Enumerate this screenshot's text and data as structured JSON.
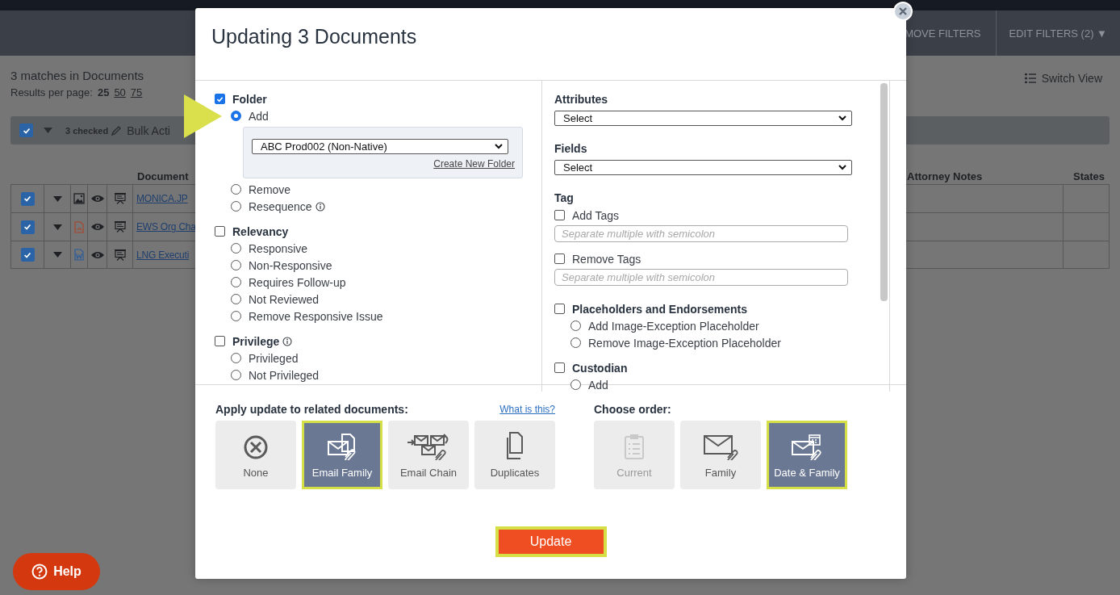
{
  "header": {
    "filters": [
      {
        "label": "MOVE FILTERS"
      },
      {
        "label": "EDIT FILTERS (2) ▼"
      }
    ]
  },
  "results": {
    "title": "3 matches in Documents",
    "per_page_label": "Results per page:",
    "per_page_options": [
      {
        "label": "25",
        "selected": true
      },
      {
        "label": "50",
        "selected": false
      },
      {
        "label": "75",
        "selected": false
      }
    ],
    "switch_view": "Switch View"
  },
  "toolbar": {
    "select_all_checked": true,
    "checked_count": "3 checked",
    "bulk_actions": "Bulk Acti"
  },
  "table": {
    "columns": [
      {
        "label": "Document"
      },
      {
        "label": "Attorney Notes"
      },
      {
        "label": "States"
      }
    ],
    "rows": [
      {
        "checked": true,
        "kind": "image",
        "document": "MONICA.JP"
      },
      {
        "checked": true,
        "kind": "pdf",
        "document": "EWS Org Cha"
      },
      {
        "checked": true,
        "kind": "word",
        "document": "LNG Executi"
      }
    ]
  },
  "help_button": "Help",
  "modal": {
    "title": "Updating 3 Documents",
    "left_sections": [
      {
        "kind": "options",
        "label": "Folder",
        "checked": true,
        "info": false,
        "options": [
          {
            "label": "Add",
            "selected": true,
            "info": false,
            "pointed": true,
            "panel": {
              "select_value": "ABC Prod002 (Non-Native)",
              "link": "Create New Folder"
            }
          },
          {
            "label": "Remove",
            "selected": false,
            "info": false,
            "pointed": false
          },
          {
            "label": "Resequence",
            "selected": false,
            "info": true,
            "pointed": false
          }
        ]
      },
      {
        "kind": "options",
        "label": "Relevancy",
        "checked": false,
        "info": false,
        "options": [
          {
            "label": "Responsive",
            "selected": false,
            "info": false,
            "pointed": false
          },
          {
            "label": "Non-Responsive",
            "selected": false,
            "info": false,
            "pointed": false
          },
          {
            "label": "Requires Follow-up",
            "selected": false,
            "info": false,
            "pointed": false
          },
          {
            "label": "Not Reviewed",
            "selected": false,
            "info": false,
            "pointed": false
          },
          {
            "label": "Remove Responsive Issue",
            "selected": false,
            "info": false,
            "pointed": false
          }
        ]
      },
      {
        "kind": "options",
        "label": "Privilege",
        "checked": false,
        "info": true,
        "options": [
          {
            "label": "Privileged",
            "selected": false,
            "info": false,
            "pointed": false
          },
          {
            "label": "Not Privileged",
            "selected": false,
            "info": false,
            "pointed": false
          }
        ]
      }
    ],
    "right_sections": [
      {
        "kind": "select",
        "label": "Attributes",
        "value": "Select"
      },
      {
        "kind": "select",
        "label": "Fields",
        "value": "Select"
      },
      {
        "kind": "tags",
        "label": "Tag",
        "items": [
          {
            "label": "Add Tags",
            "checked": false,
            "placeholder": "Separate multiple with semicolon"
          },
          {
            "label": "Remove Tags",
            "checked": false,
            "placeholder": "Separate multiple with semicolon"
          }
        ]
      },
      {
        "kind": "options",
        "label": "Placeholders and Endorsements",
        "checked": false,
        "info": false,
        "options": [
          {
            "label": "Add Image-Exception Placeholder",
            "selected": false,
            "info": false,
            "pointed": false
          },
          {
            "label": "Remove Image-Exception Placeholder",
            "selected": false,
            "info": false,
            "pointed": false
          }
        ]
      },
      {
        "kind": "options",
        "label": "Custodian",
        "checked": false,
        "info": false,
        "options": [
          {
            "label": "Add",
            "selected": false,
            "info": false,
            "pointed": false
          }
        ]
      }
    ],
    "related": {
      "label": "Apply update to related documents:",
      "link": "What is this?",
      "options": [
        {
          "label": "None",
          "kind": "none",
          "selected": false,
          "disabled": false
        },
        {
          "label": "Email Family",
          "kind": "email_family",
          "selected": true,
          "disabled": false
        },
        {
          "label": "Email Chain",
          "kind": "email_chain",
          "selected": false,
          "disabled": false
        },
        {
          "label": "Duplicates",
          "kind": "duplicates",
          "selected": false,
          "disabled": false
        }
      ]
    },
    "order": {
      "label": "Choose order:",
      "options": [
        {
          "label": "Current",
          "kind": "current",
          "selected": false,
          "disabled": true
        },
        {
          "label": "Family",
          "kind": "family",
          "selected": false,
          "disabled": false
        },
        {
          "label": "Date & Family",
          "kind": "date_family",
          "selected": true,
          "disabled": false
        }
      ]
    },
    "update_button": {
      "label": "Update",
      "highlighted": true
    }
  }
}
